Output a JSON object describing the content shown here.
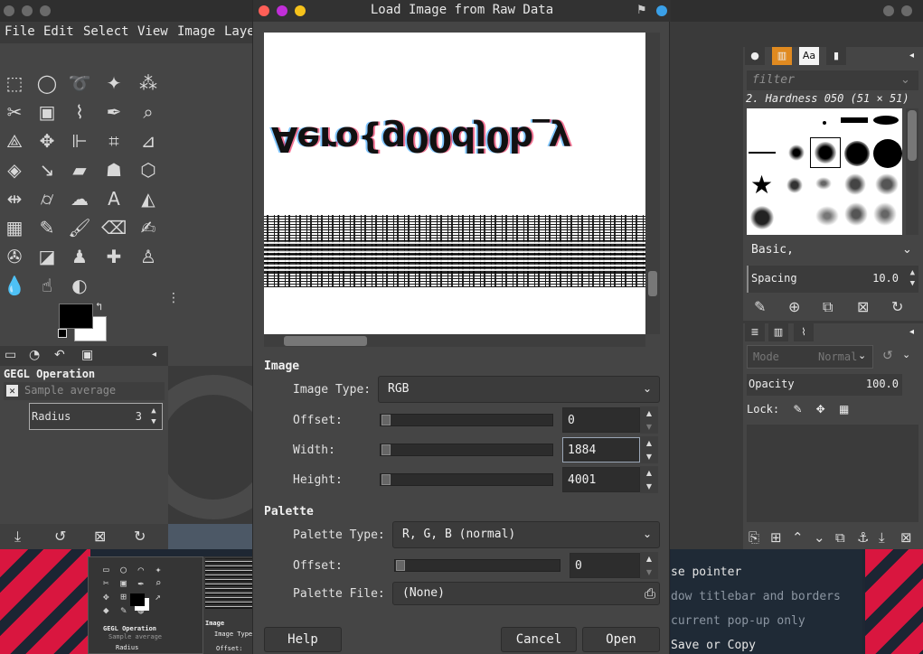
{
  "left_window": {
    "menu": [
      "File",
      "Edit",
      "Select",
      "View",
      "Image",
      "Laye"
    ],
    "gegl": {
      "title": "GEGL Operation",
      "operation": "Sample average",
      "radius_label": "Radius",
      "radius_value": "3"
    }
  },
  "dialog": {
    "title": "Load Image from Raw Data",
    "preview_text": "Aero{g00dj0b_y",
    "image_section": "Image",
    "image_type_label": "Image Type:",
    "image_type_value": "RGB",
    "offset_label": "Offset:",
    "offset_value": "0",
    "width_label": "Width:",
    "width_value": "1884",
    "height_label": "Height:",
    "height_value": "4001",
    "palette_section": "Palette",
    "palette_type_label": "Palette Type:",
    "palette_type_value": "R, G, B (normal)",
    "palette_offset_label": "Offset:",
    "palette_offset_value": "0",
    "palette_file_label": "Palette File:",
    "palette_file_value": "(None)",
    "help_button": "Help",
    "cancel_button": "Cancel",
    "open_button": "Open"
  },
  "brushes": {
    "filter_placeholder": "filter",
    "selected_brush": "2. Hardness 050 (51 × 51)",
    "tag_value": "Basic,",
    "spacing_label": "Spacing",
    "spacing_value": "10.0"
  },
  "layers": {
    "mode_label": "Mode",
    "mode_value": "Normal",
    "opacity_label": "Opacity",
    "opacity_value": "100.0",
    "lock_label": "Lock:"
  },
  "desktop_menu": {
    "items": [
      "se pointer",
      "dow titlebar and borders",
      "current pop-up only",
      "Save or Copy"
    ]
  },
  "desktop_thumbnail": {
    "gegl_title": "GEGL Operation",
    "gegl_operation": "Sample average",
    "radius_label": "Radius",
    "image_label": "Image",
    "image_type_label": "Image Type",
    "offset_label": "Offset:"
  },
  "colors": {
    "accent_red": "#d9163f",
    "dialog_bg": "#454545",
    "titlebar_close": "#ff5f57",
    "titlebar_min": "#c12ed8",
    "titlebar_max": "#f5c21b"
  }
}
